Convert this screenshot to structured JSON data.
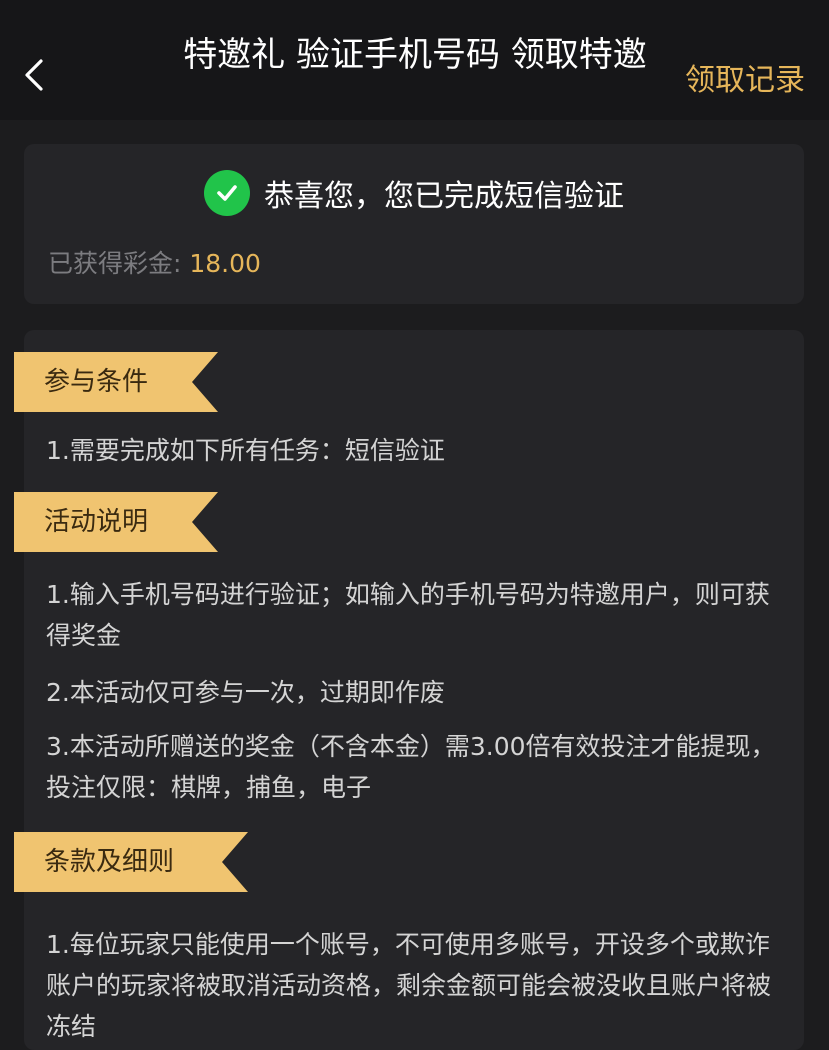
{
  "header": {
    "title": "特邀礼 验证手机号码 领取特邀",
    "records_link": "领取记录"
  },
  "success_card": {
    "message": "恭喜您，您已完成短信验证",
    "reward_label": "已获得彩金: ",
    "reward_value": "18.00"
  },
  "sections": {
    "conditions": {
      "title": "参与条件",
      "items": [
        "1.需要完成如下所有任务：短信验证"
      ]
    },
    "activity": {
      "title": "活动说明",
      "items": [
        "1.输入手机号码进行验证；如输入的手机号码为特邀用户，则可获得奖金",
        "2.本活动仅可参与一次，过期即作废",
        "3.本活动所赠送的奖金（不含本金）需3.00倍有效投注才能提现，投注仅限：棋牌，捕鱼，电子"
      ]
    },
    "terms": {
      "title": "条款及细则",
      "items": [
        "1.每位玩家只能使用一个账号，不可使用多账号，开设多个或欺诈账户的玩家将被取消活动资格，剩余金额可能会被没收且账户将被冻结"
      ]
    }
  },
  "colors": {
    "accent_gold": "#e6b65a",
    "tag_gold": "#f0c470",
    "success_green": "#21c44a",
    "background": "#1c1c1e",
    "card": "#252528"
  }
}
